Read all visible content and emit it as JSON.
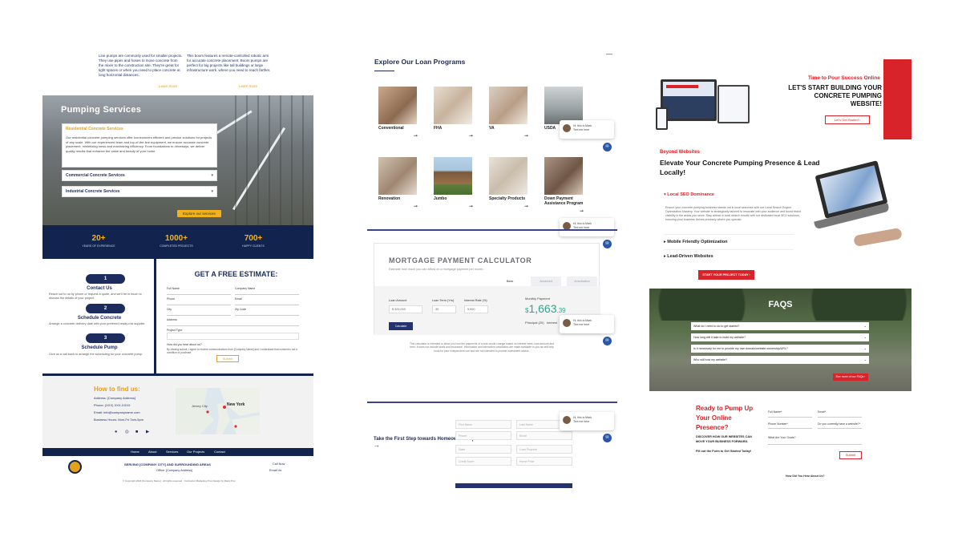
{
  "panel1": {
    "intro": {
      "left_text": "Line pumps are commonly used for smaller projects. They use pipes and hoses to move concrete from the mixer to the construction site. They're great for tight spaces or when you need to place concrete at long horizontal distances.",
      "right_text": "This boom features a remote-controlled robotic arm for accurate concrete placement. Boom pumps are perfect for big projects like tall buildings or large infrastructure work, where you need to reach farther.",
      "learn_more": "Learn more"
    },
    "services": {
      "title": "Pumping Services",
      "items": [
        {
          "label": "Residential Concrete Services",
          "body": "Our residential concrete pumping services offer homeowners efficient and precise solutions for projects of any scale. With our experienced team and top-of-the-line equipment, we ensure accurate concrete placement, minimizing mess and maximizing efficiency. From foundations to driveways, we deliver quality results that enhance the value and beauty of your home."
        },
        {
          "label": "Commercial Concrete Services"
        },
        {
          "label": "Industrial Concrete Services"
        }
      ],
      "cta": "Explore our services"
    },
    "stats": [
      {
        "number": "20+",
        "label": "YEARS OF EXPERIENCE"
      },
      {
        "number": "1000+",
        "label": "COMPLETED PROJECTS"
      },
      {
        "number": "700+",
        "label": "HAPPY CLIENTS"
      }
    ],
    "steps": [
      {
        "num": "1",
        "title": "Contact Us",
        "desc": "Reach out to us by phone or request a quote, and we'll be in touch to discuss the details of your project."
      },
      {
        "num": "2",
        "title": "Schedule Concrete",
        "desc": "Arrange a concrete delivery date with your preferred ready-mix supplier."
      },
      {
        "num": "3",
        "title": "Schedule Pump",
        "desc": "Give us a call back to arrange the scheduling for your concrete pump."
      }
    ],
    "estimate": {
      "title": "GET A FREE ESTIMATE:",
      "fields": [
        "Full Name",
        "Company Name",
        "Phone",
        "Email",
        "City",
        "Zip Code",
        "Address",
        "Project Type",
        "How did you hear about us?"
      ],
      "consent": "By clicking submit, I agree to receive communications from [Company Name] and I understand that consent is not a condition of purchase.",
      "submit": "Submit"
    },
    "find": {
      "title": "How to find us:",
      "address": "Address: [Company Address]",
      "phone": "Phone: (XXX) XXX-XXXX",
      "email": "Email: info@companyname.com",
      "hours": "Business Hours: Mon-Fri 7am-5pm",
      "map_label": "New York",
      "map_label2": "Jersey City"
    },
    "nav": [
      "Home",
      "About",
      "Services",
      "Our Projects",
      "Contact"
    ],
    "footer": {
      "serving": "SERVING [COMPANY CITY] AND SURROUNDING AREAS",
      "office": "Office: [Company Address]",
      "phone": "Call Now",
      "email": "Email Us",
      "copyright": "© Copyright 2024 [Company Name] · All rights reserved · Contractor Marketing Pros Design by Rank Pros"
    }
  },
  "panel2": {
    "title": "Explore Our Loan Programs",
    "programs": [
      {
        "name": "Conventional"
      },
      {
        "name": "FHA"
      },
      {
        "name": "VA"
      },
      {
        "name": "USDA"
      },
      {
        "name": "Renovation"
      },
      {
        "name": "Jumbo"
      },
      {
        "name": "Specialty Products"
      },
      {
        "name": "Down Payment Assistance Program"
      }
    ],
    "chat": {
      "line1": "Hi, this is Mark",
      "line2": "Text me here"
    },
    "calculator": {
      "title": "MORTGAGE PAYMENT CALCULATOR",
      "subtitle": "Estimate how much you can afford on a mortgage payment per month.",
      "tabs": [
        "Basic",
        "Advanced",
        "Amortization"
      ],
      "loan_amount_label": "Loan Amount",
      "loan_amount": "$ 325,000",
      "loan_term_label": "Loan Term (Yrs)",
      "loan_term": "30",
      "rate_label": "Interest Rate (%)",
      "rate": "5.500",
      "button": "Calculate",
      "monthly_label": "Monthly Payment",
      "monthly_dollars": "$",
      "monthly_value": "1,663",
      "monthly_cents": ".39",
      "pi_label": "Principal (20)",
      "pi_label2": "Interest",
      "disclaimer": "This calculator is intended to show you how the payments of a loan would change based on interest rates, loan amount and term. It does not include taxes and insurance. Information and interactive calculators are made available to you as self-help tools for your independent use and are not intended to provide investment advice."
    },
    "homeownership": {
      "title": "Take the First Step towards Homeownership",
      "arrow": "→"
    },
    "form_fields": [
      "First Name",
      "Last Name",
      "Phone",
      "Email",
      "State",
      "Loan Purpose",
      "Credit Score",
      "Home Price"
    ]
  },
  "panel3": {
    "banner": {
      "kicker": "Time to Pour Success Online",
      "headline": "LET'S START BUILDING YOUR CONCRETE PUMPING WEBSITE!",
      "cta": "Let's Get Started ›"
    },
    "beyond": {
      "kicker": "Beyond Websites",
      "headline": "Elevate Your Concrete Pumping Presence & Lead Locally!",
      "items": [
        {
          "label": "Local SEO Dominance",
          "body": "Ensure your concrete pumping business stands out in local searches with our Local Search Engine Optimization Mastery. Your website is strategically tailored to resonate with your audience and boost brand visibility in the areas you serve. Stay ahead in local search results with our dedicated local SEO solutions, ensuring your business thrives precisely where you operate."
        },
        {
          "label": "Mobile Friendly Optimization"
        },
        {
          "label": "Lead-Driven Websites"
        }
      ],
      "cta": "START YOUR PROJECT TODAY ›"
    },
    "faqs": {
      "title": "FAQS",
      "questions": [
        "What do I need to do to get started?",
        "How long will it take to build my website?",
        "How long will it take to build my website?",
        "Is it necessary for me to provide my own domain/website ownership/URL?",
        "Who will host my website?"
      ],
      "see_all": "See more of our FAQs ›"
    },
    "ready": {
      "title_lines": [
        "Ready to Pump Up",
        "Your Online",
        "Presence?"
      ],
      "text": "DISCOVER HOW OUR WEBSITES CAN MOVE YOUR BUSINESS FORWARD.",
      "fill": "Fill out the Form to Get Started Today!",
      "fields": [
        "Full Name*",
        "Email*",
        "Phone Number*",
        "Do you currently have a website?*",
        "What Are Your Goals?"
      ],
      "submit": "Submit",
      "bottom": "How Did You Hear About Us?"
    }
  }
}
